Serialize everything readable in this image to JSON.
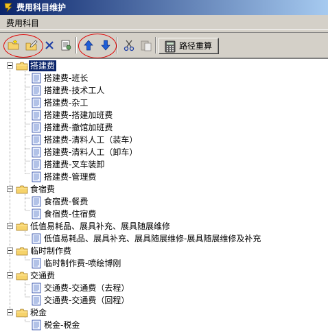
{
  "window": {
    "title": "费用科目维护"
  },
  "menu": {
    "items": [
      {
        "label": "费用科目"
      }
    ]
  },
  "toolbar": {
    "recalc_label": "路径重算"
  },
  "tree": {
    "groups": [
      {
        "label": "搭建费",
        "selected": true,
        "children": [
          "搭建费-班长",
          "搭建费-技术工人",
          "搭建费-杂工",
          "搭建费-搭建加班费",
          "搭建费-撤馆加班费",
          "搭建费-清料人工（装车）",
          "搭建费-清料人工（卸车）",
          "搭建费-叉车装卸",
          "搭建费-管理费"
        ]
      },
      {
        "label": "食宿费",
        "children": [
          "食宿费-餐费",
          "食宿费-住宿费"
        ]
      },
      {
        "label": "低值易耗品、展具补充、展具随展维修",
        "children": [
          "低值易耗品、展具补充、展具随展维修-展具随展维修及补充"
        ]
      },
      {
        "label": "临时制作费",
        "children": [
          "临时制作费-喷绘博刚"
        ]
      },
      {
        "label": "交通费",
        "children": [
          "交通费-交通费（去程）",
          "交通费-交通费（回程）"
        ]
      },
      {
        "label": "税金",
        "children": [
          "税金-税金"
        ]
      }
    ]
  },
  "colors": {
    "title_start": "#0a246a",
    "title_end": "#a6caf0",
    "selection": "#0a246a",
    "highlight_circle": "#e00000",
    "arrow_blue": "#1f5fd6"
  }
}
